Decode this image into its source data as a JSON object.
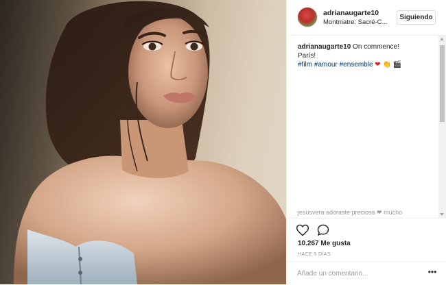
{
  "post": {
    "user": {
      "username": "adrianaugarte10",
      "avatar": "avatar-photo",
      "location": "Montmatre: Sacré-C..."
    },
    "follow_button": "Siguiendo",
    "caption": {
      "username": "adrianaugarte10",
      "line1": "On commence!",
      "line2": "París!",
      "hashtags": [
        "#film",
        "#amour",
        "#ensemble"
      ],
      "emojis": [
        "❤",
        "👏",
        "🎬"
      ]
    },
    "faded_comment": "jesusvera  adoraste  preciosa  ❤  mucho",
    "likes": "10.267 Me gusta",
    "time_ago": "HACE 5 DÍAS",
    "comment_input": {
      "placeholder": "Añade un comentario...",
      "value": ""
    },
    "icons": {
      "like": "heart-outline-icon",
      "comment": "speech-bubble-icon",
      "more": "more-options-icon"
    },
    "colors": {
      "hashtag": "#003569",
      "heart": "#ed1c24",
      "text": "#262626",
      "muted": "#999999"
    }
  }
}
